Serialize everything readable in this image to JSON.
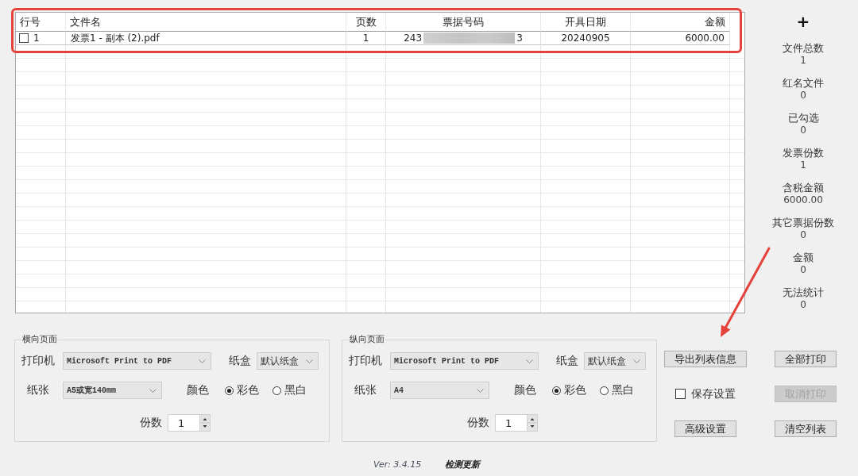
{
  "list": {
    "columns": [
      "行号",
      "文件名",
      "页数",
      "票据号码",
      "开具日期",
      "金额"
    ],
    "rows": [
      {
        "checked": false,
        "row_no": "1",
        "file_name": "发票1 - 副本 (2).pdf",
        "pages": "1",
        "invoice_no": {
          "start": "243",
          "end": "3",
          "redacted": true
        },
        "date": "20240905",
        "amount": "6000.00"
      }
    ]
  },
  "add_button": "+",
  "stats": [
    {
      "label": "文件总数",
      "value": "1"
    },
    {
      "label": "红名文件",
      "value": "0"
    },
    {
      "label": "已勾选",
      "value": "0"
    },
    {
      "label": "发票份数",
      "value": "1"
    },
    {
      "label": "含税金额",
      "value": "6000.00"
    },
    {
      "label": "其它票据份数",
      "value": "0"
    },
    {
      "label": "金额",
      "value": "0"
    },
    {
      "label": "无法统计",
      "value": "0"
    }
  ],
  "page_groups": [
    {
      "title": "横向页面",
      "printer_label": "打印机",
      "printer": "Microsoft Print to PDF",
      "tray_label": "纸盒",
      "tray": "默认纸盒",
      "paper_label": "纸张",
      "paper": "A5或宽140mm",
      "color_label": "颜色",
      "color_options": [
        {
          "label": "彩色",
          "selected": true
        },
        {
          "label": "黑白",
          "selected": false
        }
      ],
      "copies_label": "份数",
      "copies": "1"
    },
    {
      "title": "纵向页面",
      "printer_label": "打印机",
      "printer": "Microsoft Print to PDF",
      "tray_label": "纸盒",
      "tray": "默认纸盒",
      "paper_label": "纸张",
      "paper": "A4",
      "color_label": "颜色",
      "color_options": [
        {
          "label": "彩色",
          "selected": true
        },
        {
          "label": "黑白",
          "selected": false
        }
      ],
      "copies_label": "份数",
      "copies": "1"
    }
  ],
  "controls": [
    {
      "kind": "button",
      "label": "导出列表信息",
      "disabled": false
    },
    {
      "kind": "button",
      "label": "全部打印",
      "disabled": false
    },
    {
      "kind": "checkbox",
      "label": "保存设置",
      "checked": false,
      "disabled": false
    },
    {
      "kind": "button",
      "label": "取消打印",
      "disabled": true
    },
    {
      "kind": "button",
      "label": "高级设置",
      "disabled": false
    },
    {
      "kind": "button",
      "label": "清空列表",
      "disabled": false
    }
  ],
  "footer": {
    "version": "Ver: 3.4.15",
    "update_link": "检测更新"
  },
  "annotations": {
    "highlight_frame": true,
    "pointer_arrow": true
  }
}
